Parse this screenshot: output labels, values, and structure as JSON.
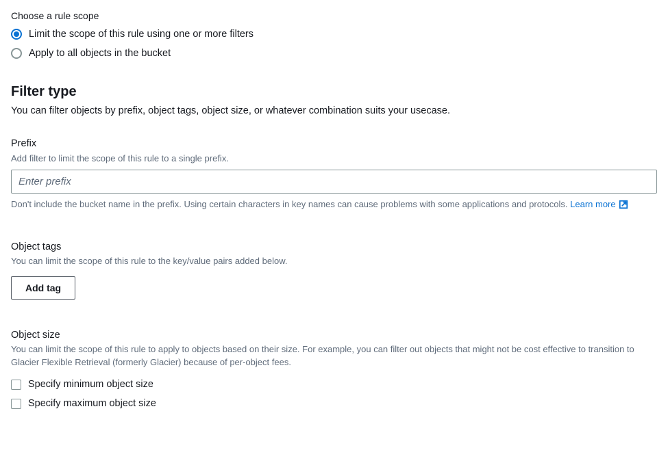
{
  "ruleScope": {
    "label": "Choose a rule scope",
    "options": {
      "limit": "Limit the scope of this rule using one or more filters",
      "all": "Apply to all objects in the bucket"
    },
    "selected": "limit"
  },
  "filterType": {
    "heading": "Filter type",
    "desc": "You can filter objects by prefix, object tags, object size, or whatever combination suits your usecase."
  },
  "prefix": {
    "label": "Prefix",
    "hint": "Add filter to limit the scope of this rule to a single prefix.",
    "placeholder": "Enter prefix",
    "belowHint": "Don't include the bucket name in the prefix. Using certain characters in key names can cause problems with some applications and protocols. ",
    "learnMore": "Learn more"
  },
  "objectTags": {
    "label": "Object tags",
    "hint": "You can limit the scope of this rule to the key/value pairs added below.",
    "button": "Add tag"
  },
  "objectSize": {
    "label": "Object size",
    "hint": "You can limit the scope of this rule to apply to objects based on their size. For example, you can filter out objects that might not be cost effective to transition to Glacier Flexible Retrieval (formerly Glacier) because of per-object fees.",
    "minLabel": "Specify minimum object size",
    "maxLabel": "Specify maximum object size"
  }
}
